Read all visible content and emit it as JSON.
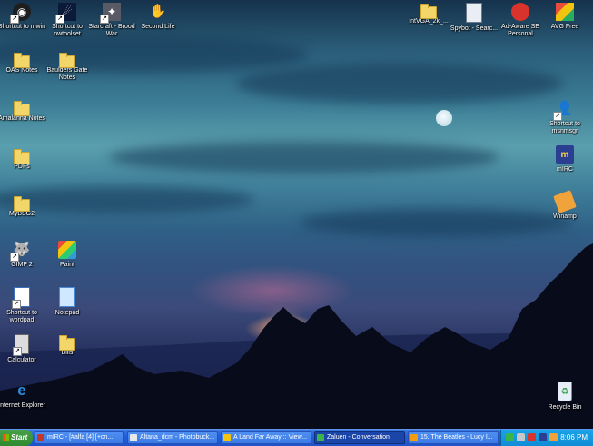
{
  "desktop": {
    "icons": [
      {
        "label": "Shortcut to mwin",
        "icon": "eye-icon"
      },
      {
        "label": "Shortcut to nwtoolset",
        "icon": "comet-icon"
      },
      {
        "label": "Starcraft - Brood War",
        "icon": "starcraft-icon"
      },
      {
        "label": "Second Life",
        "icon": "hand-icon"
      },
      {
        "label": "OAS Notes",
        "icon": "folder-icon"
      },
      {
        "label": "Baulders Gate Notes",
        "icon": "folder-icon"
      },
      {
        "label": "Amalanna Notes",
        "icon": "folder-icon"
      },
      {
        "label": "PDFs",
        "icon": "folder-icon"
      },
      {
        "label": "MyBSG2",
        "icon": "folder-icon"
      },
      {
        "label": "GIMP 2",
        "icon": "gimp-icon"
      },
      {
        "label": "Paint",
        "icon": "paint-icon"
      },
      {
        "label": "Shortcut to wordpad",
        "icon": "wordpad-icon"
      },
      {
        "label": "Notepad",
        "icon": "notepad-icon"
      },
      {
        "label": "Calculator",
        "icon": "calculator-icon"
      },
      {
        "label": "Bills",
        "icon": "folder-icon"
      },
      {
        "label": "Internet Explorer",
        "icon": "ie-icon"
      },
      {
        "label": "IntVGA_2k_...",
        "icon": "folder-icon"
      },
      {
        "label": "Spybot - Searc...",
        "icon": "spybot-icon"
      },
      {
        "label": "Ad-Aware SE Personal",
        "icon": "adaware-icon"
      },
      {
        "label": "AVG Free",
        "icon": "avg-icon"
      },
      {
        "label": "Shortcut to msnmsgr",
        "icon": "msn-icon"
      },
      {
        "label": "mIRC",
        "icon": "mirc-icon"
      },
      {
        "label": "Winamp",
        "icon": "winamp-icon"
      },
      {
        "label": "Recycle Bin",
        "icon": "recycle-bin-icon"
      }
    ]
  },
  "taskbar": {
    "start_label": "Start",
    "tasks": [
      {
        "label": "mIRC - [#alfa [4] [+cn...",
        "active": false,
        "color": "#c0392b"
      },
      {
        "label": "Altana_dcm - Photobuck...",
        "active": false,
        "color": "#e8e8e8"
      },
      {
        "label": "A Land Far Away :: View...",
        "active": false,
        "color": "#f1c40f"
      },
      {
        "label": "Zaluen - Conversation",
        "active": true,
        "color": "#3ab54a"
      },
      {
        "label": "15. The Beatles - Lucy I...",
        "active": false,
        "color": "#f39c12"
      }
    ],
    "clock": "8:06 PM"
  },
  "colors": {
    "taskbar_blue": "#245edb",
    "start_green": "#3c9a3c",
    "tray_blue": "#0f8cd6",
    "folder_yellow": "#f3d66a"
  }
}
